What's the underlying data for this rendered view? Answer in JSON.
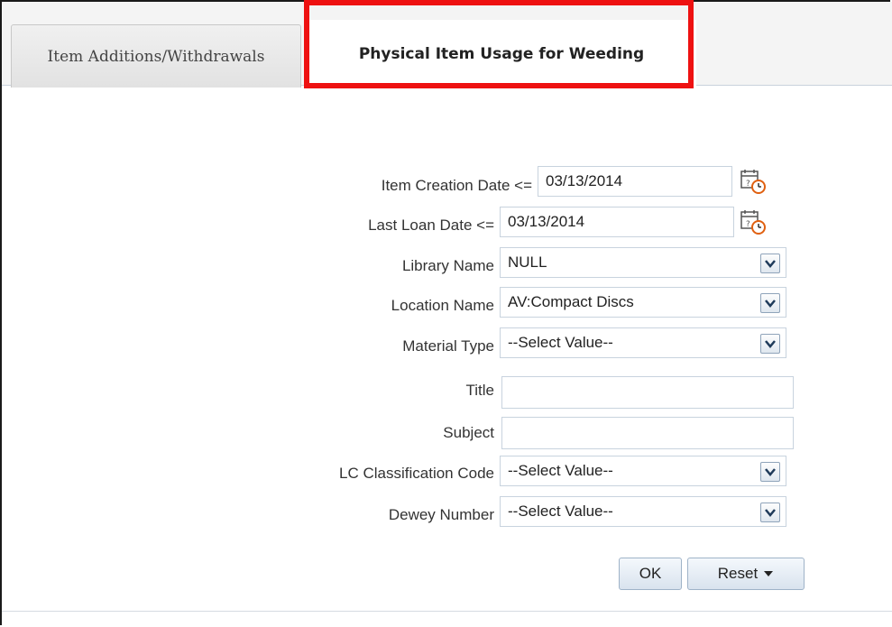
{
  "tabs": [
    {
      "label": "Item Additions/Withdrawals",
      "active": false
    },
    {
      "label": "Physical Item Usage for Weeding",
      "active": true
    }
  ],
  "form": {
    "item_creation_date": {
      "label": "Item Creation Date",
      "operator": "<=",
      "value": "03/13/2014"
    },
    "last_loan_date": {
      "label": "Last Loan Date",
      "operator": "<=",
      "value": "03/13/2014"
    },
    "library_name": {
      "label": "Library Name",
      "value": "NULL"
    },
    "location_name": {
      "label": "Location Name",
      "value": "AV:Compact Discs"
    },
    "material_type": {
      "label": "Material Type",
      "value": "--Select Value--"
    },
    "title": {
      "label": "Title",
      "value": ""
    },
    "subject": {
      "label": "Subject",
      "value": ""
    },
    "lc_classification_code": {
      "label": "LC Classification Code",
      "value": "--Select Value--"
    },
    "dewey_number": {
      "label": "Dewey Number",
      "value": "--Select Value--"
    }
  },
  "buttons": {
    "ok": "OK",
    "reset": "Reset"
  },
  "colors": {
    "highlight": "#ee1111",
    "field_border": "#c8d3de"
  },
  "icons": {
    "date_picker": "calendar-clock-icon",
    "dropdown": "chevron-down-icon",
    "reset_menu": "caret-down-icon"
  }
}
